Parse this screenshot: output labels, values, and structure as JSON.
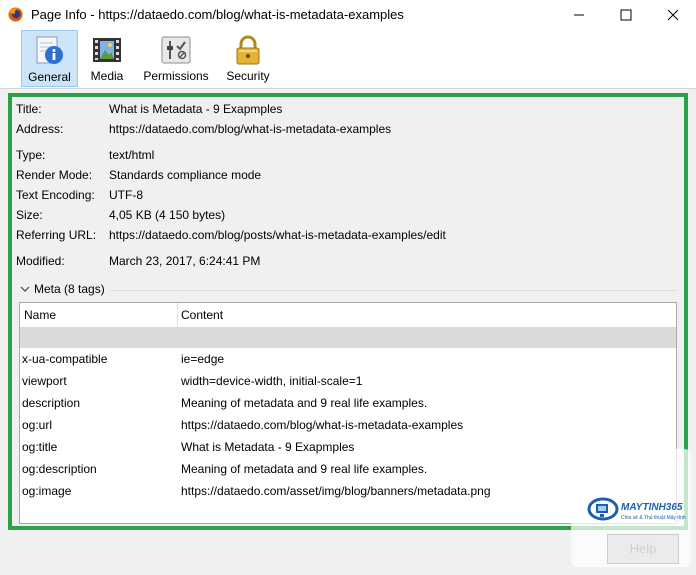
{
  "window": {
    "title": "Page Info - https://dataedo.com/blog/what-is-metadata-examples",
    "icon": "firefox-icon",
    "controls": [
      "minimize-icon",
      "maximize-icon",
      "close-icon"
    ]
  },
  "toolbar": {
    "tabs": [
      {
        "label": "General",
        "icon": "info-icon",
        "selected": true
      },
      {
        "label": "Media",
        "icon": "media-icon",
        "selected": false
      },
      {
        "label": "Permissions",
        "icon": "permissions-icon",
        "selected": false
      },
      {
        "label": "Security",
        "icon": "lock-icon",
        "selected": false
      }
    ]
  },
  "general": {
    "fields": [
      {
        "label": "Title:",
        "value": "What is Metadata - 9 Exapmples"
      },
      {
        "label": "Address:",
        "value": "https://dataedo.com/blog/what-is-metadata-examples"
      },
      {
        "label": "Type:",
        "value": "text/html"
      },
      {
        "label": "Render Mode:",
        "value": "Standards compliance mode"
      },
      {
        "label": "Text Encoding:",
        "value": "UTF-8"
      },
      {
        "label": "Size:",
        "value": "4,05 KB (4 150 bytes)"
      },
      {
        "label": "Referring URL:",
        "value": "https://dataedo.com/blog/posts/what-is-metadata-examples/edit"
      },
      {
        "label": "Modified:",
        "value": "March 23, 2017, 6:24:41 PM"
      }
    ]
  },
  "meta": {
    "toggle_label": "Meta (8 tags)",
    "columns": [
      "Name",
      "Content"
    ],
    "rows": [
      {
        "name": "",
        "content": "",
        "selected": true
      },
      {
        "name": "x-ua-compatible",
        "content": "ie=edge"
      },
      {
        "name": "viewport",
        "content": "width=device-width, initial-scale=1"
      },
      {
        "name": "description",
        "content": "Meaning of metadata and 9 real life examples."
      },
      {
        "name": "og:url",
        "content": "https://dataedo.com/blog/what-is-metadata-examples"
      },
      {
        "name": "og:title",
        "content": "What is Metadata - 9 Exapmples"
      },
      {
        "name": "og:description",
        "content": "Meaning of metadata and 9 real life examples."
      },
      {
        "name": "og:image",
        "content": "https://dataedo.com/asset/img/blog/banners/metadata.png"
      }
    ]
  },
  "watermark": {
    "brand": "MAYTINH365",
    "tagline": "Chia sẻ & Thủ thuật Máy tính"
  },
  "footer": {
    "help_label": "Help"
  },
  "colors": {
    "highlight_frame": "#2aa24a",
    "selected_tab_bg": "#cce4f7",
    "selected_row_bg": "#dadada"
  }
}
